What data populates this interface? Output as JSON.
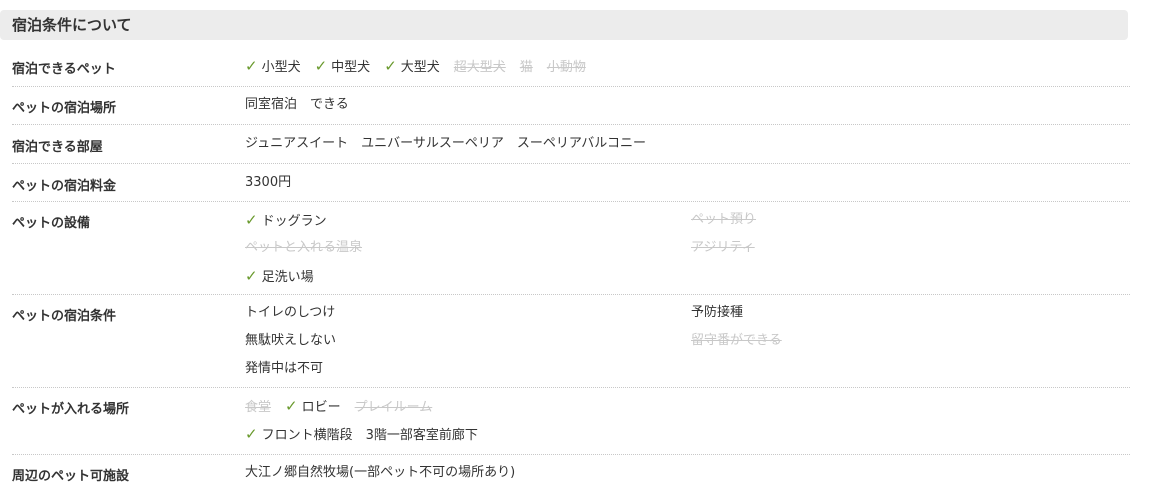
{
  "section": {
    "title": "宿泊条件について"
  },
  "pet_types": {
    "label": "宿泊できるペット",
    "items": [
      {
        "text": "小型犬",
        "ok": true
      },
      {
        "text": "中型犬",
        "ok": true
      },
      {
        "text": "大型犬",
        "ok": true
      },
      {
        "text": "超大型犬",
        "ok": false
      },
      {
        "text": "猫",
        "ok": false
      },
      {
        "text": "小動物",
        "ok": false
      }
    ]
  },
  "stay_place": {
    "label": "ペットの宿泊場所",
    "value": "同室宿泊　できる"
  },
  "rooms": {
    "label": "宿泊できる部屋",
    "value": "ジュニアスイート　ユニバーサルスーペリア　スーペリアバルコニー"
  },
  "fee": {
    "label": "ペットの宿泊料金",
    "value": "3300円"
  },
  "facilities": {
    "label": "ペットの設備",
    "items": [
      {
        "text": "ドッグラン",
        "ok": true
      },
      {
        "text": "ペット預り",
        "ok": false
      },
      {
        "text": "ペットと入れる温泉",
        "ok": false
      },
      {
        "text": "アジリティ",
        "ok": false
      },
      {
        "text": "足洗い場",
        "ok": true
      }
    ]
  },
  "conditions": {
    "label": "ペットの宿泊条件",
    "items": [
      {
        "text": "トイレのしつけ",
        "ok": true
      },
      {
        "text": "予防接種",
        "ok": true
      },
      {
        "text": "無駄吠えしない",
        "ok": true
      },
      {
        "text": "留守番ができる",
        "ok": false
      },
      {
        "text": "発情中は不可",
        "ok": true
      }
    ]
  },
  "areas": {
    "label": "ペットが入れる場所",
    "items": [
      {
        "text": "食堂",
        "ok": false
      },
      {
        "text": "ロビー",
        "ok": true
      },
      {
        "text": "プレイルーム",
        "ok": false
      },
      {
        "text": "フロント横階段　3階一部客室前廊下",
        "ok": true
      }
    ]
  },
  "nearby": {
    "label": "周辺のペット可施設",
    "value": "大江ノ郷自然牧場(一部ペット不可の場所あり)"
  },
  "colors": {
    "check": "#6a9a2e",
    "disabled": "#c8c8c8",
    "header_bg": "#ececec"
  }
}
